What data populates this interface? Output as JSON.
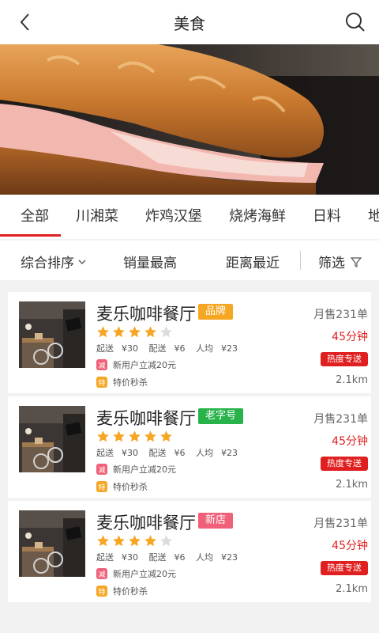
{
  "header": {
    "title": "美食"
  },
  "categories": [
    {
      "label": "全部",
      "active": true
    },
    {
      "label": "川湘菜"
    },
    {
      "label": "炸鸡汉堡"
    },
    {
      "label": "烧烤海鲜"
    },
    {
      "label": "日料"
    },
    {
      "label": "地方"
    }
  ],
  "sort": {
    "overall": "综合排序",
    "sales": "销量最高",
    "distance": "距离最近",
    "filter": "筛选"
  },
  "colors": {
    "accent": "#e02020",
    "star": "#f5a623",
    "badge_brand": "#f5a623",
    "badge_old": "#27b24a",
    "badge_new": "#f06078"
  },
  "restaurants": [
    {
      "name": "麦乐咖啡餐厅",
      "badge": "品牌",
      "badge_color": "#f5a623",
      "rating": 4,
      "min_label": "起送",
      "min": "¥30",
      "fee_label": "配送",
      "fee": "¥6",
      "avg_label": "人均",
      "avg": "¥23",
      "promo1_icon": "减",
      "promo1": "新用户立减20元",
      "promo2_icon": "特",
      "promo2": "特价秒杀",
      "sales": "月售231单",
      "time": "45分钟",
      "tag": "热度专送",
      "distance": "2.1km"
    },
    {
      "name": "麦乐咖啡餐厅",
      "badge": "老字号",
      "badge_color": "#27b24a",
      "rating": 5,
      "min_label": "起送",
      "min": "¥30",
      "fee_label": "配送",
      "fee": "¥6",
      "avg_label": "人均",
      "avg": "¥23",
      "promo1_icon": "减",
      "promo1": "新用户立减20元",
      "promo2_icon": "特",
      "promo2": "特价秒杀",
      "sales": "月售231单",
      "time": "45分钟",
      "tag": "热度专送",
      "distance": "2.1km"
    },
    {
      "name": "麦乐咖啡餐厅",
      "badge": "新店",
      "badge_color": "#f06078",
      "rating": 4,
      "min_label": "起送",
      "min": "¥30",
      "fee_label": "配送",
      "fee": "¥6",
      "avg_label": "人均",
      "avg": "¥23",
      "promo1_icon": "减",
      "promo1": "新用户立减20元",
      "promo2_icon": "特",
      "promo2": "特价秒杀",
      "sales": "月售231单",
      "time": "45分钟",
      "tag": "热度专送",
      "distance": "2.1km"
    }
  ]
}
